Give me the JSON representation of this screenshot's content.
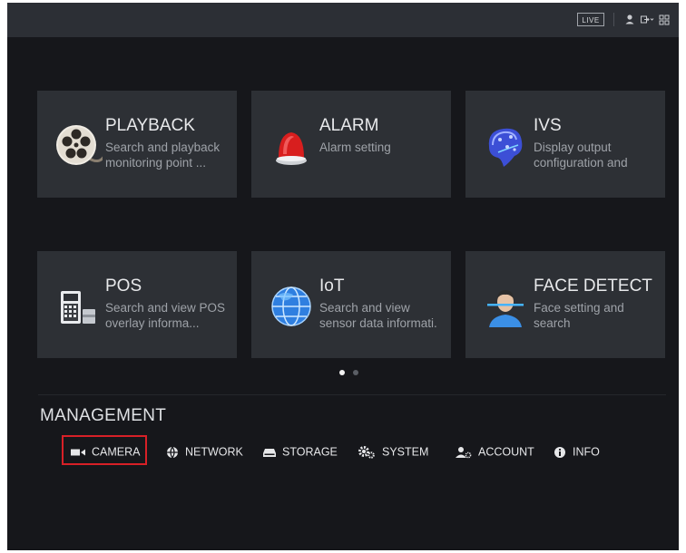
{
  "topbar": {
    "live_label": "LIVE",
    "icons": [
      "user-icon",
      "logout-icon",
      "grid-menu-icon"
    ]
  },
  "tiles": [
    {
      "title": "PLAYBACK",
      "desc_line1": "Search and playback",
      "desc_line2": "monitoring point ...",
      "icon": "film-reel-icon"
    },
    {
      "title": "ALARM",
      "desc_line1": "Alarm setting",
      "desc_line2": "",
      "icon": "siren-icon"
    },
    {
      "title": "IVS",
      "desc_line1": "Display output",
      "desc_line2": "configuration and",
      "icon": "brain-icon"
    },
    {
      "title": "POS",
      "desc_line1": "Search and view POS",
      "desc_line2": "overlay informa...",
      "icon": "pos-terminal-icon"
    },
    {
      "title": "IoT",
      "desc_line1": "Search and view",
      "desc_line2": "sensor data informati.",
      "icon": "globe-icon"
    },
    {
      "title": "FACE DETECT",
      "desc_line1": "Face setting and",
      "desc_line2": "search",
      "icon": "face-scan-icon"
    }
  ],
  "pagination": {
    "pages": 2,
    "current": 1
  },
  "management": {
    "title": "MANAGEMENT",
    "items": [
      {
        "label": "CAMERA",
        "icon": "camera-icon",
        "selected": true
      },
      {
        "label": "NETWORK",
        "icon": "network-icon"
      },
      {
        "label": "STORAGE",
        "icon": "storage-icon"
      },
      {
        "label": "SYSTEM",
        "icon": "gear-icon"
      },
      {
        "label": "ACCOUNT",
        "icon": "account-icon"
      },
      {
        "label": "INFO",
        "icon": "info-icon"
      }
    ]
  },
  "colors": {
    "background": "#16171b",
    "tile": "#2d3035",
    "topbar": "#2c2f35",
    "highlight": "#d82027"
  }
}
